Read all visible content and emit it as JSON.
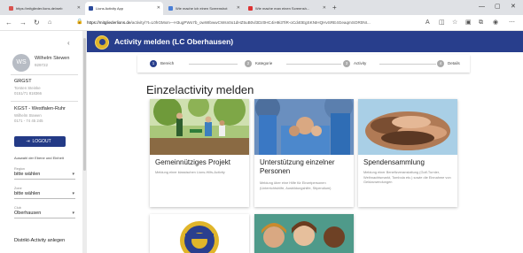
{
  "browser": {
    "tabs": [
      {
        "title": "https://mitglieder.lions.de/web",
        "fav": "#d9534f",
        "active": false
      },
      {
        "title": "Lions Activity App",
        "fav": "#2b4a9b",
        "active": true
      },
      {
        "title": "Wie mache ich einen Screenshot",
        "fav": "#4a7fd6",
        "active": false
      },
      {
        "title": "Wie mache man einen Screensh...",
        "fav": "#d33",
        "active": false
      }
    ],
    "url_host": "https://mitgliederlions.de",
    "url_path": "/activity/?t=L0hGMxm—H3ugPWo7b_owWIbwwCWsn0o1dHZ5uB0vl3Dz0HC4iH9i3TiR-oCd40EgSKNIHQHvSRE4GeaqmSOR0NI..."
  },
  "sidebar": {
    "avatar_initials": "WS",
    "user_name": "Wilhelm Stewen",
    "user_id": "929722",
    "org1": {
      "title": "GRGST",
      "line1": "Torsten Steinke",
      "line2": "0151/71 818366"
    },
    "org2": {
      "title": "KGST - Westfalen-Ruhr",
      "line1": "Wilhelm Stewen",
      "line2": "0171 - 74 45 245"
    },
    "logout_label": "LOGOUT",
    "level_hint": "Auswahl der Ebene und Einheit",
    "selects": [
      {
        "caption": "Region",
        "value": "bitte wählen"
      },
      {
        "caption": "Zone",
        "value": "bitte wählen"
      },
      {
        "caption": "Club",
        "value": "Oberhausen"
      }
    ],
    "district_link": "Distrikt-Activity anlegen"
  },
  "appbar": {
    "title": "Activity melden (LC Oberhausen)"
  },
  "stepper": {
    "steps": [
      {
        "num": "1",
        "label": "Bereich"
      },
      {
        "num": "2",
        "label": "Kategorie"
      },
      {
        "num": "3",
        "label": "Activity"
      },
      {
        "num": "4",
        "label": "Details"
      }
    ]
  },
  "main": {
    "heading": "Einzelactivity melden",
    "cards": [
      {
        "title": "Gemeinnütziges Projekt",
        "desc": "Meldung einer klassischen Lions-Hilfs-Activity"
      },
      {
        "title": "Unterstützung einzelner Personen",
        "desc": "Meldung über eine Hilfe für Einzelpersonen (Unterrichtshilfe, Ausbildungshilfe, Stipendium)"
      },
      {
        "title": "Spendensammlung",
        "desc": "Meldung einer Benefizveranstaltung (Golf-Turnier, Weihnachtsmarkt, Tombola etc.) sowie die Einnahme von Geldzuwendungen"
      }
    ]
  },
  "colors": {
    "brand": "#283e8c",
    "accent": "#e0b52a"
  }
}
